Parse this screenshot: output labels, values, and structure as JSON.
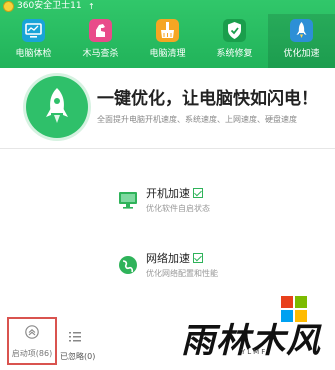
{
  "window": {
    "title": "360安全卫士11",
    "upgrade_glyph": "↑"
  },
  "tabs": [
    {
      "label": "电脑体检",
      "icon": "monitor-icon",
      "active": false
    },
    {
      "label": "木马查杀",
      "icon": "horse-icon",
      "active": false
    },
    {
      "label": "电脑清理",
      "icon": "broom-icon",
      "active": false
    },
    {
      "label": "系统修复",
      "icon": "shield-icon",
      "active": false
    },
    {
      "label": "优化加速",
      "icon": "rocket-icon",
      "active": true
    }
  ],
  "hero": {
    "title": "一键优化，让电脑快如闪电！",
    "subtitle": "全面提升电脑开机速度、系统速度、上网速度、硬盘速度",
    "icon": "rocket-icon"
  },
  "items": [
    {
      "name": "开机加速",
      "desc": "优化软件自启状态",
      "icon": "monitor-icon",
      "checked": true
    },
    {
      "name": "网络加速",
      "desc": "优化网络配置和性能",
      "icon": "globe-icon",
      "checked": true
    }
  ],
  "bottom": {
    "startup_label": "启动项(86)",
    "ignored_label": "已忽略(0)"
  },
  "watermark": {
    "text": "雨林木风",
    "sub": "YLMF"
  },
  "colors": {
    "brand_green": "#21b35a",
    "highlight_red": "#d9534f",
    "checkbox_green": "#2fb35a"
  }
}
